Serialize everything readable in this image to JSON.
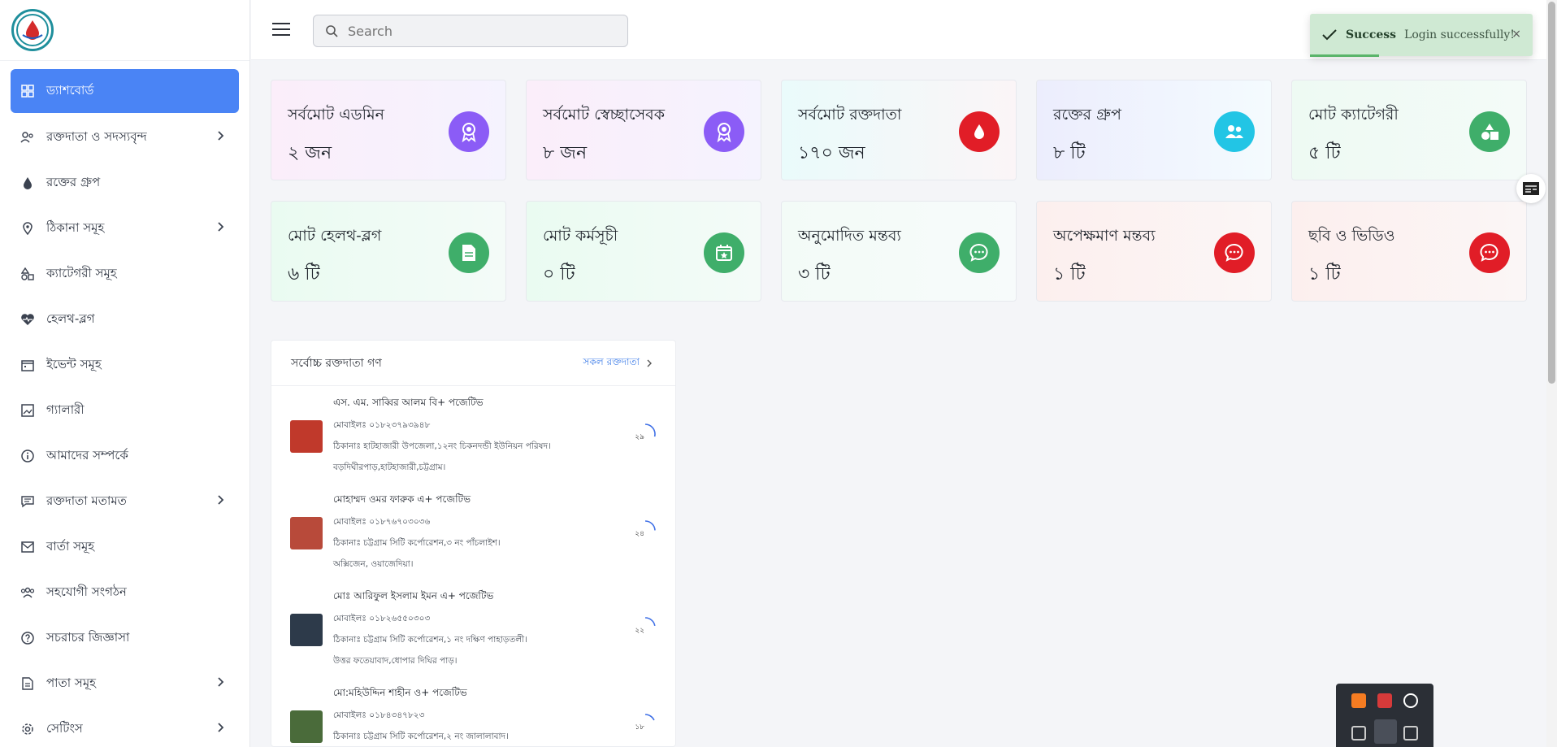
{
  "sidebar": {
    "items": [
      {
        "label": "ড্যাশবোর্ড",
        "icon": "dashboard-icon",
        "active": true,
        "chevron": false
      },
      {
        "label": "রক্তদাতা ও সদস্যবৃন্দ",
        "icon": "users-icon",
        "chevron": true
      },
      {
        "label": "রক্তের গ্রুপ",
        "icon": "drop-icon",
        "chevron": false
      },
      {
        "label": "ঠিকানা সমূহ",
        "icon": "location-icon",
        "chevron": true
      },
      {
        "label": "ক্যাটেগরী সমূহ",
        "icon": "shapes-icon",
        "chevron": false
      },
      {
        "label": "হেলথ-ব্লগ",
        "icon": "heartbeat-icon",
        "chevron": false
      },
      {
        "label": "ইভেন্ট সমূহ",
        "icon": "calendar-icon",
        "chevron": false
      },
      {
        "label": "গ্যালারী",
        "icon": "image-icon",
        "chevron": false
      },
      {
        "label": "আমাদের সম্পর্কে",
        "icon": "info-icon",
        "chevron": false
      },
      {
        "label": "রক্তদাতা মতামত",
        "icon": "comment-icon",
        "chevron": true
      },
      {
        "label": "বার্তা সমূহ",
        "icon": "mail-icon",
        "chevron": false
      },
      {
        "label": "সহযোগী সংগঠন",
        "icon": "group-icon",
        "chevron": false
      },
      {
        "label": "সচরাচর জিজ্ঞাসা",
        "icon": "question-icon",
        "chevron": false
      },
      {
        "label": "পাতা সমূহ",
        "icon": "page-icon",
        "chevron": true
      },
      {
        "label": "সেটিংস",
        "icon": "settings-icon",
        "chevron": true
      }
    ]
  },
  "search": {
    "placeholder": "Search"
  },
  "toast": {
    "title": "Success",
    "message": "Login successfully!",
    "close": "×"
  },
  "cards": [
    {
      "title": "সর্বমোট এডমিন",
      "value": "২ জন",
      "color": "#8b5cf6",
      "icon": "award-icon"
    },
    {
      "title": "সর্বমোট স্বেচ্ছাসেবক",
      "value": "৮ জন",
      "color": "#8b5cf6",
      "icon": "award-icon"
    },
    {
      "title": "সর্বমোট রক্তদাতা",
      "value": "১৭০ জন",
      "color": "#e11d27",
      "icon": "drop-icon"
    },
    {
      "title": "রক্তের গ্রুপ",
      "value": "৮ টি",
      "color": "#22c5e5",
      "icon": "group-icon"
    },
    {
      "title": "মোট ক্যাটেগরী",
      "value": "৫ টি",
      "color": "#3fae6a",
      "icon": "shapes-icon"
    },
    {
      "title": "মোট হেলথ-ব্লগ",
      "value": "৬ টি",
      "color": "#3fae6a",
      "icon": "document-icon"
    },
    {
      "title": "মোট কর্মসূচী",
      "value": "০ টি",
      "color": "#3fae6a",
      "icon": "calendar-star-icon"
    },
    {
      "title": "অনুমোদিত মন্তব্য",
      "value": "৩ টি",
      "color": "#3fae6a",
      "icon": "chat-icon"
    },
    {
      "title": "অপেক্ষমাণ মন্তব্য",
      "value": "১ টি",
      "color": "#e11d27",
      "icon": "chat-icon"
    },
    {
      "title": "ছবি ও ভিডিও",
      "value": "১ টি",
      "color": "#e11d27",
      "icon": "chat-icon"
    }
  ],
  "donors": {
    "title": "সর্বোচ্চ রক্তদাতা গণ",
    "link": "সকল রক্তদাতা",
    "items": [
      {
        "name": "এস. এম. সাব্বির আলম বি+ পজেটিভ",
        "mobile": "মোবাইলঃ ০১৮২৩৭৯৩৯৪৮",
        "address1": "ঠিকানাঃ হাটহাজারী উপজেলা,১২নং চিকনদন্ডী ইউনিয়ন পরিষদ।",
        "address2": "বড়দিঘীরপাড়,হাটহাজারী,চট্টগ্রাম।",
        "count": "২৯",
        "progress": 0.29,
        "avatar": "#c0392b"
      },
      {
        "name": "মোহাম্মদ ওমর ফারুক এ+ পজেটিভ",
        "mobile": "মোবাইলঃ ০১৮৭৬৭০৩০৩৬",
        "address1": "ঠিকানাঃ চট্টগ্রাম সিটি কর্পোরেশন,৩ নং পাঁচলাইশ।",
        "address2": "অক্সিজেন, ওয়াজেদিয়া।",
        "count": "২৪",
        "progress": 0.24,
        "avatar": "#b84a3a"
      },
      {
        "name": "মোঃ আরিফুল ইসলাম ইমন এ+ পজেটিভ",
        "mobile": "মোবাইলঃ ০১৮২৬৫৫০৩০৩",
        "address1": "ঠিকানাঃ চট্টগ্রাম সিটি কর্পোরেশন,১ নং দক্ষিণ পাহাড়তলী।",
        "address2": "উত্তর ফতেয়াবাদ,ধোপার দিঘির পাড়।",
        "count": "২২",
        "progress": 0.22,
        "avatar": "#2d3a4a"
      },
      {
        "name": "মো:মহিউদ্দিন শাহীন ও+ পজেটিভ",
        "mobile": "মোবাইলঃ ০১৮৪৩৪৭৮২৩",
        "address1": "ঠিকানাঃ চট্টগ্রাম সিটি কর্পোরেশন,২ নং জালালাবাদ।",
        "address2": "",
        "count": "১৮",
        "progress": 0.18,
        "avatar": "#4a6b3a"
      }
    ]
  }
}
